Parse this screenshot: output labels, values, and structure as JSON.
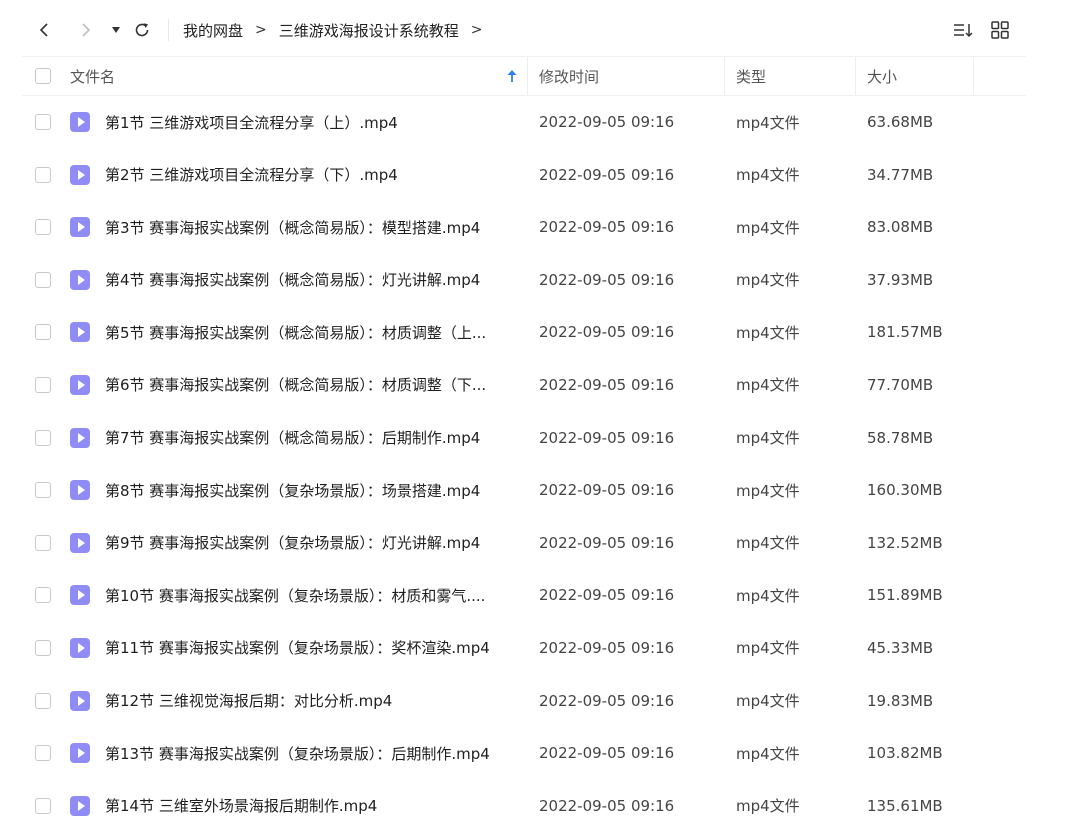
{
  "toolbar": {
    "back_icon": "chevron-left-icon",
    "forward_icon": "chevron-right-icon",
    "dropdown_icon": "caret-down-icon",
    "refresh_icon": "refresh-icon",
    "sort_icon": "sort-list-icon",
    "grid_icon": "grid-view-icon"
  },
  "breadcrumb": {
    "items": [
      "我的网盘",
      "三维游戏海报设计系统教程"
    ],
    "separator": ">"
  },
  "table": {
    "columns": {
      "name": "文件名",
      "modified": "修改时间",
      "type": "类型",
      "size": "大小"
    },
    "sort_indicator_color": "#2f7ff6",
    "rows": [
      {
        "name": "第1节 三维游戏项目全流程分享（上）.mp4",
        "modified": "2022-09-05 09:16",
        "type": "mp4文件",
        "size": "63.68MB"
      },
      {
        "name": "第2节 三维游戏项目全流程分享（下）.mp4",
        "modified": "2022-09-05 09:16",
        "type": "mp4文件",
        "size": "34.77MB"
      },
      {
        "name": "第3节 赛事海报实战案例（概念简易版）：模型搭建.mp4",
        "modified": "2022-09-05 09:16",
        "type": "mp4文件",
        "size": "83.08MB"
      },
      {
        "name": "第4节 赛事海报实战案例（概念简易版）：灯光讲解.mp4",
        "modified": "2022-09-05 09:16",
        "type": "mp4文件",
        "size": "37.93MB"
      },
      {
        "name": "第5节 赛事海报实战案例（概念简易版）：材质调整（上...",
        "modified": "2022-09-05 09:16",
        "type": "mp4文件",
        "size": "181.57MB"
      },
      {
        "name": "第6节 赛事海报实战案例（概念简易版）：材质调整（下...",
        "modified": "2022-09-05 09:16",
        "type": "mp4文件",
        "size": "77.70MB"
      },
      {
        "name": "第7节 赛事海报实战案例（概念简易版）：后期制作.mp4",
        "modified": "2022-09-05 09:16",
        "type": "mp4文件",
        "size": "58.78MB"
      },
      {
        "name": "第8节 赛事海报实战案例（复杂场景版）：场景搭建.mp4",
        "modified": "2022-09-05 09:16",
        "type": "mp4文件",
        "size": "160.30MB"
      },
      {
        "name": "第9节 赛事海报实战案例（复杂场景版）：灯光讲解.mp4",
        "modified": "2022-09-05 09:16",
        "type": "mp4文件",
        "size": "132.52MB"
      },
      {
        "name": "第10节 赛事海报实战案例（复杂场景版）：材质和雾气....",
        "modified": "2022-09-05 09:16",
        "type": "mp4文件",
        "size": "151.89MB"
      },
      {
        "name": "第11节 赛事海报实战案例（复杂场景版）：奖杯渲染.mp4",
        "modified": "2022-09-05 09:16",
        "type": "mp4文件",
        "size": "45.33MB"
      },
      {
        "name": "第12节 三维视觉海报后期：对比分析.mp4",
        "modified": "2022-09-05 09:16",
        "type": "mp4文件",
        "size": "19.83MB"
      },
      {
        "name": "第13节 赛事海报实战案例（复杂场景版）：后期制作.mp4",
        "modified": "2022-09-05 09:16",
        "type": "mp4文件",
        "size": "103.82MB"
      },
      {
        "name": "第14节 三维室外场景海报后期制作.mp4",
        "modified": "2022-09-05 09:16",
        "type": "mp4文件",
        "size": "135.61MB"
      }
    ]
  }
}
